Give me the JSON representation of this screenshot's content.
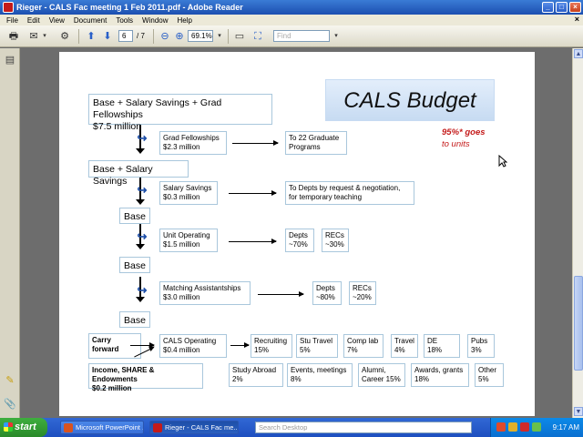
{
  "window": {
    "title": "Rieger - CALS Fac meeting 1 Feb 2011.pdf - Adobe Reader"
  },
  "menu": [
    "File",
    "Edit",
    "View",
    "Document",
    "Tools",
    "Window",
    "Help"
  ],
  "menu_close": "×",
  "toolbar": {
    "page_current": "6",
    "page_total": "/ 7",
    "zoom": "69.1%",
    "find_placeholder": "Find"
  },
  "slide": {
    "title": "CALS Budget",
    "note_bold": "95%* goes",
    "note_rest": "to units",
    "top_box": [
      "Base + Salary Savings + Grad Fellowships",
      "$7.5 million"
    ],
    "grad_fellowships": [
      "Grad Fellowships",
      "$2.3 million"
    ],
    "grad_programs": [
      "To 22 Graduate",
      "Programs"
    ],
    "base_salary": "Base + Salary Savings",
    "salary_savings": [
      "Salary Savings",
      "$0.3 million"
    ],
    "salary_dest": [
      "To Depts by request & negotiation,",
      "for temporary teaching"
    ],
    "base1": "Base",
    "unit_operating": [
      "Unit Operating",
      "$1.5 million"
    ],
    "unit_depts": [
      "Depts",
      "~70%"
    ],
    "unit_recs": [
      "RECs",
      "~30%"
    ],
    "base2": "Base",
    "matching": [
      "Matching Assistantships",
      "$3.0 million"
    ],
    "match_depts": [
      "Depts",
      "~80%"
    ],
    "match_recs": [
      "RECs",
      "~20%"
    ],
    "base3": "Base",
    "carry_forward": [
      "Carry",
      "forward"
    ],
    "cals_operating": [
      "CALS Operating",
      "$0.4 million"
    ],
    "recruiting": [
      "Recruiting",
      "15%"
    ],
    "stu_travel": [
      "Stu Travel",
      "5%"
    ],
    "comp_lab": [
      "Comp lab",
      "7%"
    ],
    "travel": [
      "Travel",
      "4%"
    ],
    "de": [
      "DE",
      "18%"
    ],
    "pubs": [
      "Pubs",
      "3%"
    ],
    "income": [
      "Income, SHARE & Endowments",
      "$0.2 million"
    ],
    "study_abroad": [
      "Study Abroad",
      "2%"
    ],
    "events": [
      "Events, meetings",
      "8%"
    ],
    "alumni": [
      "Alumni,",
      "Career 15%"
    ],
    "awards": [
      "Awards, grants",
      "18%"
    ],
    "other": [
      "Other",
      "5%"
    ]
  },
  "taskbar": {
    "start": "start",
    "tasks": [
      "Microsoft PowerPoint ...",
      "Rieger - CALS Fac me..."
    ],
    "search_placeholder": "Search Desktop",
    "clock": "9:17 AM"
  },
  "colors": {
    "accent": "#1e4fa8",
    "note_red": "#c41a1a",
    "box_border": "#a9c7dc"
  }
}
